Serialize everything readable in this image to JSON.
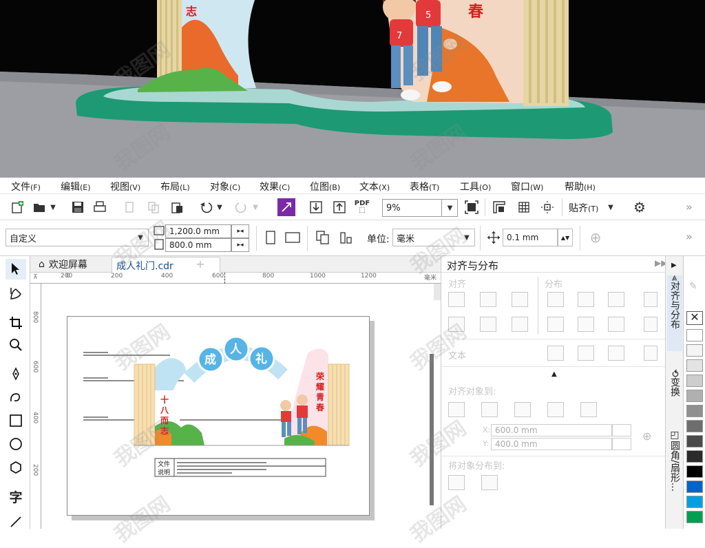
{
  "menu": [
    {
      "label": "文件",
      "key": "(F)"
    },
    {
      "label": "编辑",
      "key": "(E)"
    },
    {
      "label": "视图",
      "key": "(V)"
    },
    {
      "label": "布局",
      "key": "(L)"
    },
    {
      "label": "对象",
      "key": "(C)"
    },
    {
      "label": "效果",
      "key": "(C)"
    },
    {
      "label": "位图",
      "key": "(B)"
    },
    {
      "label": "文本",
      "key": "(X)"
    },
    {
      "label": "表格",
      "key": "(T)"
    },
    {
      "label": "工具",
      "key": "(O)"
    },
    {
      "label": "窗口",
      "key": "(W)"
    },
    {
      "label": "帮助",
      "key": "(H)"
    }
  ],
  "toolbar": {
    "zoom": "9%",
    "snap_label": "贴齐",
    "snap_key": "(T)",
    "pdf_label": "PDF",
    "more": "»"
  },
  "propbar": {
    "page_preset": "自定义",
    "width": "1,200.0 mm",
    "height": "800.0 mm",
    "unit_label": "单位:",
    "unit_value": "毫米",
    "nudge": "0.1 mm",
    "more": "»"
  },
  "tabs": {
    "home": "欢迎屏幕",
    "doc": "成人礼门.cdr",
    "add": "+"
  },
  "ruler": {
    "ticks": [
      "200",
      "0",
      "200",
      "400",
      "600",
      "800",
      "1000",
      "1200"
    ],
    "unit": "毫米",
    "vticks": [
      "800",
      "600",
      "400",
      "200"
    ]
  },
  "artwork": {
    "title_chars": [
      "成",
      "人",
      "礼"
    ],
    "left_slogan": "十八而志",
    "right_slogan": "荣耀青春",
    "jersey_left": "7",
    "jersey_right": "5",
    "caption_label_1": "文件",
    "caption_label_2": "说明"
  },
  "docker": {
    "title": "对齐与分布",
    "align_label": "对齐",
    "distribute_label": "分布",
    "text_label": "文本",
    "align_to_label": "对齐对象到:",
    "x_label": "X:",
    "x_value": "600.0 mm",
    "y_label": "Y:",
    "y_value": "400.0 mm",
    "distribute_to_label": "将对象分布到:"
  },
  "vtabs": [
    "对齐与分布",
    "变换",
    "圆角/扇形..."
  ],
  "palette_colors": [
    "#ffffff",
    "#f4f4f4",
    "#e3e3e3",
    "#cdcdcd",
    "#b0b0b0",
    "#909090",
    "#6e6e6e",
    "#4a4a4a",
    "#2a2a2a",
    "#000000",
    "#0064c8",
    "#00a0e0",
    "#00a050"
  ],
  "watermark": "我图网",
  "colors": {
    "accent": "#1e78d0",
    "arch_blue": "#56b4e6",
    "turf": "#1ea477",
    "slogan_red": "#d42020"
  }
}
